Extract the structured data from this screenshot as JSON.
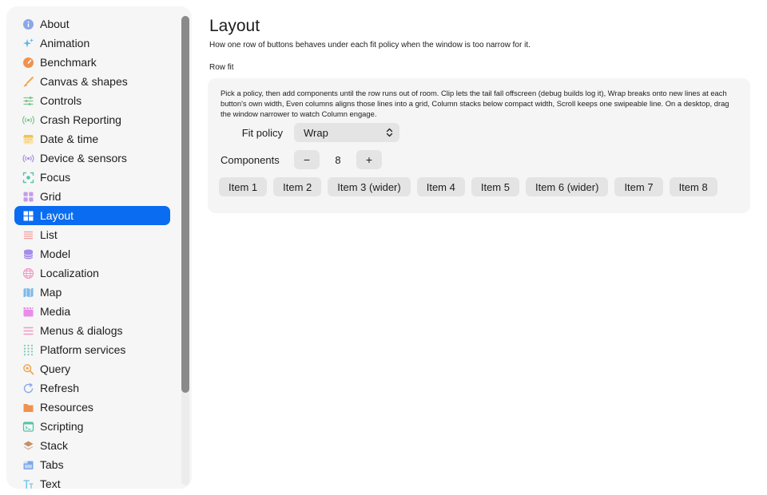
{
  "sidebar": {
    "items": [
      {
        "label": "About",
        "icon": "info-icon",
        "color": "#8aa8e8"
      },
      {
        "label": "Animation",
        "icon": "sparkles-icon",
        "color": "#5ab8e8"
      },
      {
        "label": "Benchmark",
        "icon": "gauge-icon",
        "color": "#f0924e"
      },
      {
        "label": "Canvas & shapes",
        "icon": "brush-icon",
        "color": "#f0a654"
      },
      {
        "label": "Controls",
        "icon": "sliders-icon",
        "color": "#7cc68c"
      },
      {
        "label": "Crash Reporting",
        "icon": "broadcast-icon",
        "color": "#7cc68c"
      },
      {
        "label": "Date & time",
        "icon": "calendar-icon",
        "color": "#f2c44e"
      },
      {
        "label": "Device & sensors",
        "icon": "sensor-icon",
        "color": "#a48ce8"
      },
      {
        "label": "Focus",
        "icon": "focus-icon",
        "color": "#54c4a8"
      },
      {
        "label": "Grid",
        "icon": "grid-icon",
        "color": "#c49ce8"
      },
      {
        "label": "Layout",
        "icon": "layout-icon",
        "color": "#ffffff"
      },
      {
        "label": "List",
        "icon": "list-icon",
        "color": "#f09a9a"
      },
      {
        "label": "Model",
        "icon": "database-icon",
        "color": "#a48ce8"
      },
      {
        "label": "Localization",
        "icon": "globe-icon",
        "color": "#f09ac4"
      },
      {
        "label": "Map",
        "icon": "map-icon",
        "color": "#7cb8e8"
      },
      {
        "label": "Media",
        "icon": "clapperboard-icon",
        "color": "#e88ce8"
      },
      {
        "label": "Menus & dialogs",
        "icon": "menu-icon",
        "color": "#f09ac4"
      },
      {
        "label": "Platform services",
        "icon": "dots-grid-icon",
        "color": "#7cc6b8"
      },
      {
        "label": "Query",
        "icon": "magnifier-icon",
        "color": "#f0a654"
      },
      {
        "label": "Refresh",
        "icon": "refresh-icon",
        "color": "#8aa8e8"
      },
      {
        "label": "Resources",
        "icon": "folder-icon",
        "color": "#f0924e"
      },
      {
        "label": "Scripting",
        "icon": "terminal-icon",
        "color": "#54c4a8"
      },
      {
        "label": "Stack",
        "icon": "layers-icon",
        "color": "#c4906a"
      },
      {
        "label": "Tabs",
        "icon": "tabs-icon",
        "color": "#7ca8e8"
      },
      {
        "label": "Text",
        "icon": "text-icon",
        "color": "#7cc8e8"
      }
    ],
    "selected_index": 10,
    "selected_color": "#0a6cf0"
  },
  "main": {
    "title": "Layout",
    "subtitle": "How one row of buttons behaves under each fit policy when the window is too narrow for it.",
    "section_label": "Row fit",
    "card": {
      "description": "Pick a policy, then add components until the row runs out of room. Clip lets the tail fall offscreen (debug builds log it), Wrap breaks onto new lines at each button's own width, Even columns aligns those lines into a grid, Column stacks below compact width, Scroll keeps one swipeable line. On a desktop, drag the window narrower to watch Column engage.",
      "fit_policy_label": "Fit policy",
      "fit_policy_value": "Wrap",
      "components_label": "Components",
      "decrement_label": "−",
      "components_count": "8",
      "increment_label": "+",
      "items": [
        "Item 1",
        "Item 2",
        "Item 3 (wider)",
        "Item 4",
        "Item 5",
        "Item 6 (wider)",
        "Item 7",
        "Item 8"
      ]
    }
  }
}
